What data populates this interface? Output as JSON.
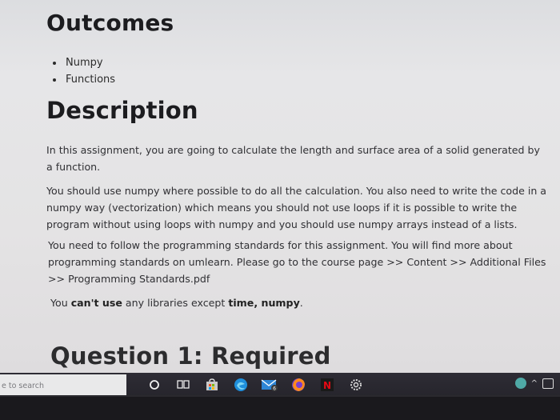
{
  "outcomes": {
    "heading": "Outcomes",
    "items": [
      "Numpy",
      "Functions"
    ]
  },
  "description": {
    "heading": "Description",
    "para1": "In this assignment, you are going to calculate the length and surface area of a solid generated by a function.",
    "para2": "You should use numpy where possible to do all the calculation. You also need to write the code in a numpy way (vectorization) which  means you should not use  loops if it is possible to write the program without using loops with numpy and you should use numpy arrays instead of a lists.",
    "para3": "You need to follow the programming standards for this assignment. You will find more about programming standards on umlearn. Please go to the course page >> Content >> Additional Files >> Programming Standards.pdf",
    "para4": {
      "prefix": "You ",
      "bold1": "can't use",
      "middle": " any libraries except ",
      "bold2": "time, numpy",
      "suffix": "."
    }
  },
  "question": {
    "heading": "Question 1: Required"
  },
  "taskbar": {
    "search_text": "e to search",
    "icons": [
      "task-view-icon",
      "widgets-icon",
      "store-icon",
      "edge-icon",
      "mail-icon",
      "firefox-icon",
      "netflix-icon",
      "settings-icon"
    ],
    "tray_icons": [
      "help-icon",
      "chevron-up-icon",
      "tray-app-icon"
    ]
  },
  "colors": {
    "page_bg": "#e4e3e4",
    "heading": "#1c1c1f",
    "taskbar": "#2a2930",
    "search_bg": "#e9e9ea"
  }
}
